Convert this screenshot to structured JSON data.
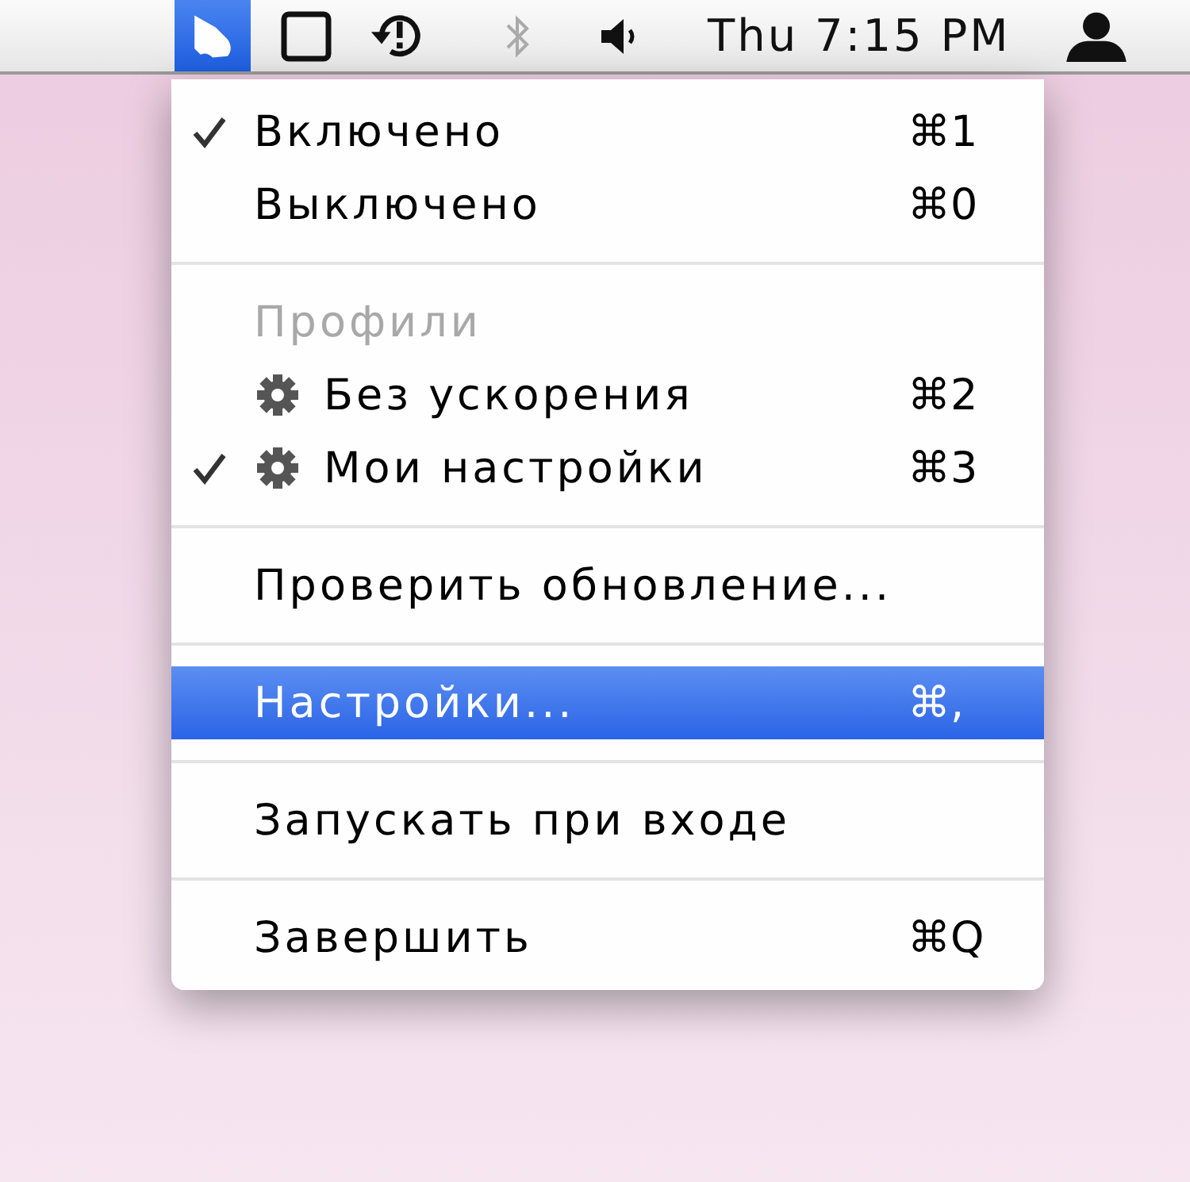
{
  "menu_bar": {
    "status_items": [
      {
        "kind": "app",
        "selected": true,
        "disabled": false
      },
      {
        "kind": "square",
        "selected": false,
        "disabled": false
      },
      {
        "kind": "history",
        "selected": false,
        "disabled": false
      },
      {
        "kind": "bluetooth",
        "selected": false,
        "disabled": true
      },
      {
        "kind": "volume",
        "selected": false,
        "disabled": false
      },
      {
        "kind": "clock",
        "text": "Thu 7:15 PM",
        "selected": false,
        "disabled": false
      },
      {
        "kind": "user",
        "selected": false,
        "disabled": false
      }
    ]
  },
  "menu": {
    "items": [
      {
        "kind": "item",
        "label": "Включено",
        "shortcut": "⌘1",
        "checked": true,
        "selected": false
      },
      {
        "kind": "item",
        "label": "Выключено",
        "shortcut": "⌘0",
        "checked": false,
        "selected": false
      },
      {
        "kind": "separator"
      },
      {
        "kind": "header",
        "label": "Профили"
      },
      {
        "kind": "profile",
        "label": "Без ускорения",
        "shortcut": "⌘2",
        "checked": false,
        "selected": false
      },
      {
        "kind": "profile",
        "label": "Мои настройки",
        "shortcut": "⌘3",
        "checked": true,
        "selected": false
      },
      {
        "kind": "separator"
      },
      {
        "kind": "item",
        "label": "Проверить обновление...",
        "checked": false,
        "selected": false
      },
      {
        "kind": "separator"
      },
      {
        "kind": "item",
        "label": "Настройки...",
        "shortcut": "⌘,",
        "checked": false,
        "selected": true
      },
      {
        "kind": "separator"
      },
      {
        "kind": "item",
        "label": "Запускать при входе",
        "checked": false,
        "selected": false
      },
      {
        "kind": "separator"
      },
      {
        "kind": "item",
        "label": "Завершить",
        "shortcut": "⌘Q",
        "checked": false,
        "selected": false
      }
    ]
  }
}
